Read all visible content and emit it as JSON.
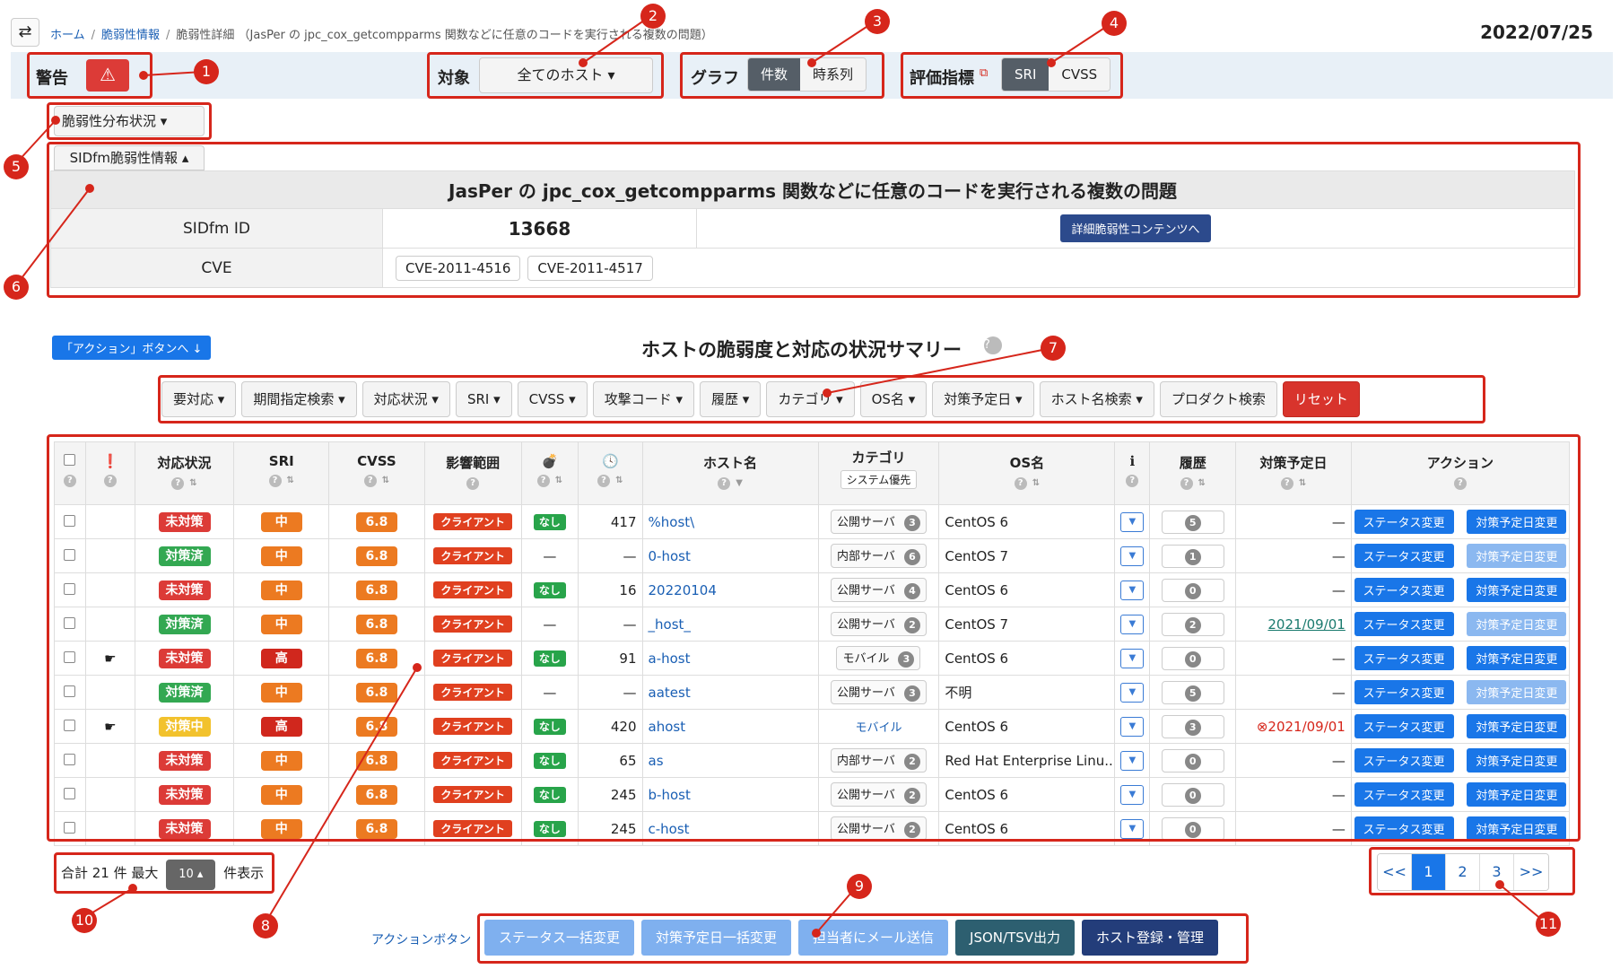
{
  "breadcrumb": {
    "home": "ホーム",
    "vuln_info": "脆弱性情報",
    "current": "脆弱性詳細 （JasPer の jpc_cox_getcompparms 関数などに任意のコードを実行される複数の問題）"
  },
  "date": "2022/07/25",
  "topbar": {
    "warning_label": "警告",
    "warning_icon": "warning-triangle-icon",
    "target_label": "対象",
    "target_value": "全てのホスト ▾",
    "graph_label": "グラフ",
    "graph_options": [
      "件数",
      "時系列"
    ],
    "graph_selected": "件数",
    "metric_label": "評価指標",
    "metric_options": [
      "SRI",
      "CVSS"
    ],
    "metric_selected": "SRI"
  },
  "view_select": "脆弱性分布状況 ▾",
  "info_panel": {
    "toggle_label": "SIDfm脆弱性情報 ▴",
    "title": "JasPer の jpc_cox_getcompparms 関数などに任意のコードを実行される複数の問題",
    "sidfm_id_label": "SIDfm ID",
    "sidfm_id": "13668",
    "detail_button": "詳細脆弱性コンテンツへ",
    "cve_label": "CVE",
    "cves": [
      "CVE-2011-4516",
      "CVE-2011-4517"
    ]
  },
  "jump_button": "「アクション」ボタンへ ↓",
  "summary_title": "ホストの脆弱度と対応の状況サマリー",
  "filters": [
    "要対応 ▾",
    "期間指定検索 ▾",
    "対応状況 ▾",
    "SRI ▾",
    "CVSS ▾",
    "攻撃コード ▾",
    "履歴 ▾",
    "カテゴリ ▾",
    "OS名 ▾",
    "対策予定日 ▾",
    "ホスト名検索 ▾",
    "プロダクト検索",
    "リセット"
  ],
  "table": {
    "headers": {
      "status": "対応状況",
      "sri": "SRI",
      "cvss": "CVSS",
      "scope": "影響範囲",
      "host": "ホスト名",
      "category": "カテゴリ",
      "category_sub": "システム優先",
      "os": "OS名",
      "history": "履歴",
      "due": "対策予定日",
      "action": "アクション"
    },
    "rows": [
      {
        "flag": "",
        "status": "未対策",
        "status_color": "#dc3b37",
        "sri": "中",
        "sri_color": "#ec7a21",
        "cvss": "6.8",
        "scope": "クライアント",
        "exploit": "なし",
        "days": "417",
        "host": "%host\\",
        "category": "公開サーバ",
        "cat_n": "3",
        "os": "CentOS 6",
        "hist": "5",
        "due": "—",
        "btn1": "ステータス変更",
        "btn2": "対策予定日変更",
        "btn2_light": false
      },
      {
        "flag": "",
        "status": "対策済",
        "status_color": "#33a852",
        "sri": "中",
        "sri_color": "#ec7a21",
        "cvss": "6.8",
        "scope": "クライアント",
        "exploit": "—",
        "days": "—",
        "host": "0-host",
        "category": "内部サーバ",
        "cat_n": "6",
        "os": "CentOS 7",
        "hist": "1",
        "due": "—",
        "btn1": "ステータス変更",
        "btn2": "対策予定日変更",
        "btn2_light": true
      },
      {
        "flag": "",
        "status": "未対策",
        "status_color": "#dc3b37",
        "sri": "中",
        "sri_color": "#ec7a21",
        "cvss": "6.8",
        "scope": "クライアント",
        "exploit": "なし",
        "days": "16",
        "host": "20220104",
        "category": "公開サーバ",
        "cat_n": "4",
        "os": "CentOS 6",
        "hist": "0",
        "due": "—",
        "btn1": "ステータス変更",
        "btn2": "対策予定日変更",
        "btn2_light": false
      },
      {
        "flag": "",
        "status": "対策済",
        "status_color": "#33a852",
        "sri": "中",
        "sri_color": "#ec7a21",
        "cvss": "6.8",
        "scope": "クライアント",
        "exploit": "—",
        "days": "—",
        "host": "_host_",
        "category": "公開サーバ",
        "cat_n": "2",
        "os": "CentOS 7",
        "hist": "2",
        "due": "2021/09/01",
        "btn1": "ステータス変更",
        "btn2": "対策予定日変更",
        "btn2_light": true
      },
      {
        "flag": "☛",
        "status": "未対策",
        "status_color": "#dc3b37",
        "sri": "高",
        "sri_color": "#d0271d",
        "cvss": "6.8",
        "scope": "クライアント",
        "exploit": "なし",
        "days": "91",
        "host": "a-host",
        "category": "モバイル",
        "cat_n": "3",
        "os": "CentOS 6",
        "hist": "0",
        "due": "—",
        "btn1": "ステータス変更",
        "btn2": "対策予定日変更",
        "btn2_light": false
      },
      {
        "flag": "",
        "status": "対策済",
        "status_color": "#33a852",
        "sri": "中",
        "sri_color": "#ec7a21",
        "cvss": "6.8",
        "scope": "クライアント",
        "exploit": "—",
        "days": "—",
        "host": "aatest",
        "category": "公開サーバ",
        "cat_n": "3",
        "os": "不明",
        "hist": "5",
        "due": "—",
        "btn1": "ステータス変更",
        "btn2": "対策予定日変更",
        "btn2_light": true
      },
      {
        "flag": "☛",
        "status": "対策中",
        "status_color": "#f2c22d",
        "sri": "高",
        "sri_color": "#d0271d",
        "cvss": "6.8",
        "scope": "クライアント",
        "exploit": "なし",
        "days": "420",
        "host": "ahost",
        "category": "モバイル",
        "cat_n": "",
        "os": "CentOS 6",
        "hist": "3",
        "due": "⊗2021/09/01",
        "btn1": "ステータス変更",
        "btn2": "対策予定日変更",
        "btn2_light": false
      },
      {
        "flag": "",
        "status": "未対策",
        "status_color": "#dc3b37",
        "sri": "中",
        "sri_color": "#ec7a21",
        "cvss": "6.8",
        "scope": "クライアント",
        "exploit": "なし",
        "days": "65",
        "host": "as",
        "category": "内部サーバ",
        "cat_n": "2",
        "os": "Red Hat Enterprise Linu...",
        "hist": "0",
        "due": "—",
        "btn1": "ステータス変更",
        "btn2": "対策予定日変更",
        "btn2_light": false
      },
      {
        "flag": "",
        "status": "未対策",
        "status_color": "#dc3b37",
        "sri": "中",
        "sri_color": "#ec7a21",
        "cvss": "6.8",
        "scope": "クライアント",
        "exploit": "なし",
        "days": "245",
        "host": "b-host",
        "category": "公開サーバ",
        "cat_n": "2",
        "os": "CentOS 6",
        "hist": "0",
        "due": "—",
        "btn1": "ステータス変更",
        "btn2": "対策予定日変更",
        "btn2_light": false
      },
      {
        "flag": "",
        "status": "未対策",
        "status_color": "#dc3b37",
        "sri": "中",
        "sri_color": "#ec7a21",
        "cvss": "6.8",
        "scope": "クライアント",
        "exploit": "なし",
        "days": "245",
        "host": "c-host",
        "category": "公開サーバ",
        "cat_n": "2",
        "os": "CentOS 6",
        "hist": "0",
        "due": "—",
        "btn1": "ステータス変更",
        "btn2": "対策予定日変更",
        "btn2_light": false
      }
    ]
  },
  "footer": {
    "total_prefix": "合計 21 件  最大",
    "per_page": "10 ▴",
    "suffix": "件表示",
    "pages": [
      "<<",
      "1",
      "2",
      "3",
      ">>"
    ],
    "current_page": "1",
    "action_label": "アクションボタン",
    "bulk_buttons": [
      "ステータス一括変更",
      "対策予定日一括変更",
      "担当者にメール送信",
      "JSON/TSV出力",
      "ホスト登録・管理"
    ]
  },
  "callouts": [
    "1",
    "2",
    "3",
    "4",
    "5",
    "6",
    "7",
    "8",
    "9",
    "10",
    "11"
  ],
  "colors": {
    "annotation": "#d6261b",
    "primary": "#1976e8",
    "navy": "#2c4a8c"
  }
}
